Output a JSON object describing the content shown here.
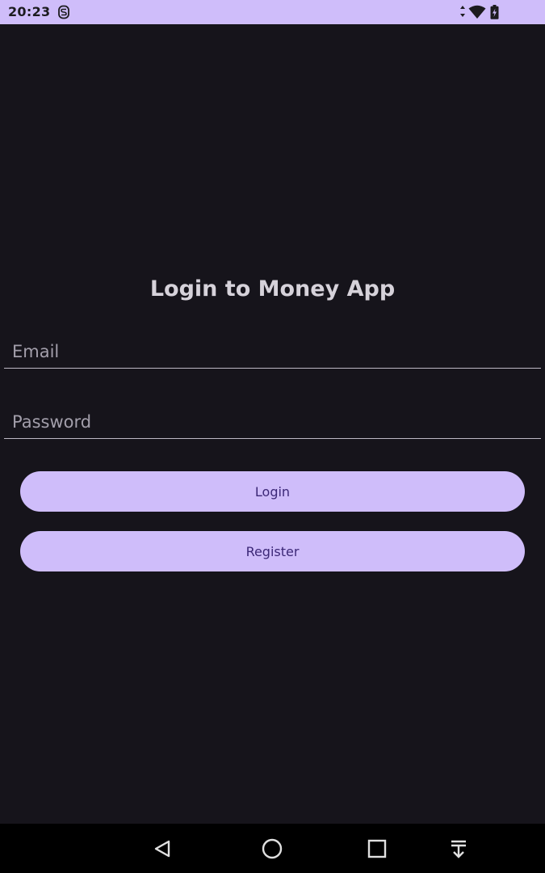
{
  "status_bar": {
    "time": "20:23",
    "icons": [
      "notification-s-icon",
      "data-arrows-icon",
      "wifi-icon",
      "battery-charging-icon"
    ]
  },
  "login": {
    "title": "Login to Money App",
    "email_placeholder": "Email",
    "email_value": "",
    "password_placeholder": "Password",
    "password_value": "",
    "login_label": "Login",
    "register_label": "Register"
  },
  "nav_bar": {
    "icons": [
      "back-icon",
      "home-icon",
      "recents-icon",
      "keyboard-hide-icon"
    ]
  },
  "colors": {
    "background": "#16141b",
    "accent": "#cfbdfa",
    "button_text": "#3c2877",
    "title_text": "#d6d2da"
  }
}
